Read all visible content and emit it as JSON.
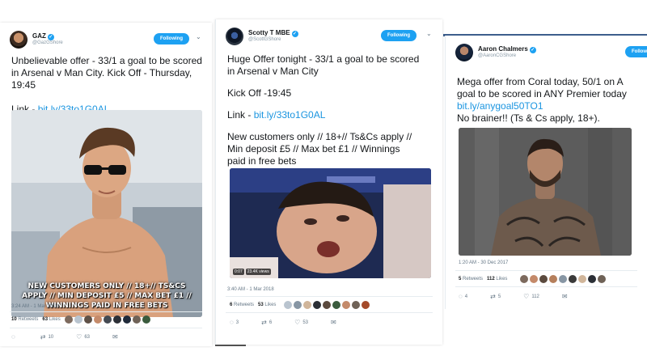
{
  "tweets": [
    {
      "name": "GAZ",
      "handle": "@GazGShore",
      "follow_label": "Following",
      "lines": [
        "Unbelievable offer - 33/1 a goal to be scored",
        "in Arsenal v Man City. Kick Off - Thursday,",
        "19:45",
        "",
        "Link - "
      ],
      "link": "bit.ly/33to1G0AL",
      "image_overlay": [
        "NEW CUSTOMERS ONLY // 18+// TS&CS",
        "APPLY // MIN DEPOSIT £5 // MAX BET £1 //",
        "WINNINGS PAID IN FREE BETS"
      ],
      "timestamp": "3:24 AM - 1 Mar 2018",
      "retweets": "10",
      "retweets_label": "Retweets",
      "likes": "63",
      "likes_label": "Likes",
      "reply_count": "",
      "retweet_count": "10",
      "like_count": "63"
    },
    {
      "name": "Scotty T MBE",
      "handle": "@ScottGShore",
      "follow_label": "Following",
      "lines": [
        "Huge Offer tonight - 33/1 a goal to be scored",
        "in Arsenal v Man City",
        "",
        "Kick Off -19:45",
        "",
        "Link - ",
        "",
        "New customers only // 18+// Ts&Cs apply //",
        "Min deposit £5 // Max bet £1 // Winnings",
        "paid in free bets"
      ],
      "link": "bit.ly/33to1G0AL",
      "video_duration": "0:07",
      "video_views": "23.4K views",
      "timestamp": "3:40 AM - 1 Mar 2018",
      "retweets": "6",
      "retweets_label": "Retweets",
      "likes": "53",
      "likes_label": "Likes",
      "reply_count": "3",
      "retweet_count": "6",
      "like_count": "53"
    },
    {
      "name": "Aaron Chalmers",
      "handle": "@AaronCGShore",
      "follow_label": "Follow",
      "lines": [
        "Mega offer from Coral today, 50/1 on A",
        "goal to be scored in ANY Premier today"
      ],
      "link": "bit.ly/anygoal50TO1",
      "last_line": "No brainer!! (Ts & Cs apply, 18+).",
      "timestamp": "1:20 AM - 30 Dec 2017",
      "retweets": "5",
      "retweets_label": "Retweets",
      "likes": "112",
      "likes_label": "Likes",
      "reply_count": "4",
      "retweet_count": "5",
      "like_count": "112"
    }
  ],
  "colors": {
    "link": "#1b95e0",
    "follow_button": "#1da1f2",
    "muted": "#657786",
    "top_line": "#3d5e8c"
  },
  "icons": [
    "verified-icon",
    "chevron-down-icon",
    "reply-icon",
    "retweet-icon",
    "like-icon",
    "message-icon"
  ]
}
